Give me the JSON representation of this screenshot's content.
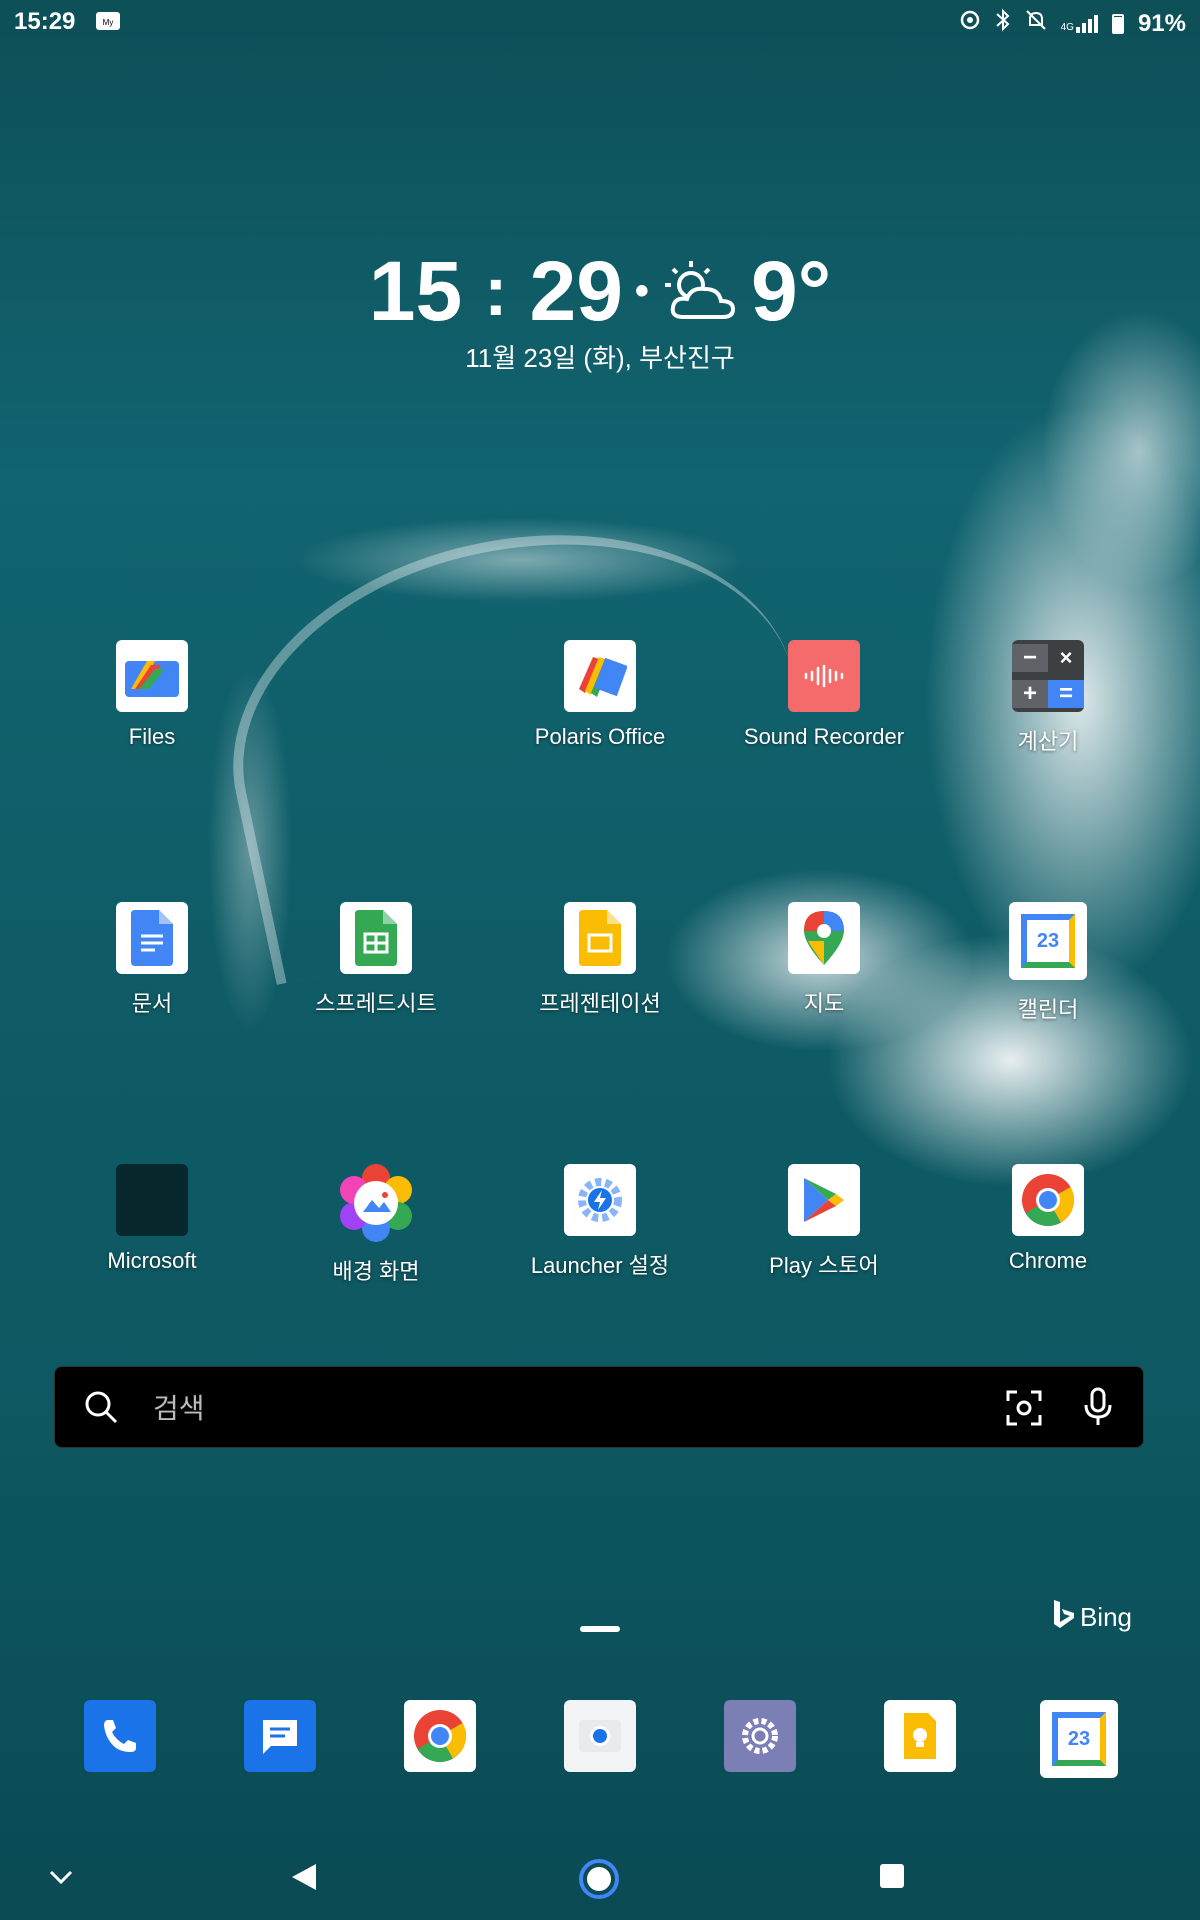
{
  "status_bar": {
    "time": "15:29",
    "badge_text": "My",
    "battery": "91%",
    "network": "4G"
  },
  "clock_widget": {
    "hour": "15",
    "minute": "29",
    "temperature": "9°",
    "date_location": "11월 23일 (화), 부산진구",
    "weather_icon": "partly-cloudy-icon"
  },
  "apps": {
    "files": "Files",
    "polaris": "Polaris Office",
    "recorder": "Sound Recorder",
    "calculator": "계산기",
    "docs": "문서",
    "sheets": "스프레드시트",
    "slides": "프레젠테이션",
    "maps": "지도",
    "calendar": "캘린더",
    "microsoft": "Microsoft",
    "wallpaper": "배경 화면",
    "launcher": "Launcher 설정",
    "play": "Play 스토어",
    "chrome": "Chrome",
    "calendar_day": "23"
  },
  "search": {
    "placeholder": "검색"
  },
  "bing": {
    "label": "Bing"
  },
  "dock": [
    "phone-icon",
    "messages-icon",
    "chrome-icon",
    "camera-icon",
    "settings-icon",
    "keep-icon",
    "calendar-icon"
  ],
  "colors": {
    "ocean": "#0f5c66",
    "google_blue": "#4285F4",
    "google_red": "#EA4335",
    "google_yellow": "#FBBC04",
    "google_green": "#34A853"
  }
}
